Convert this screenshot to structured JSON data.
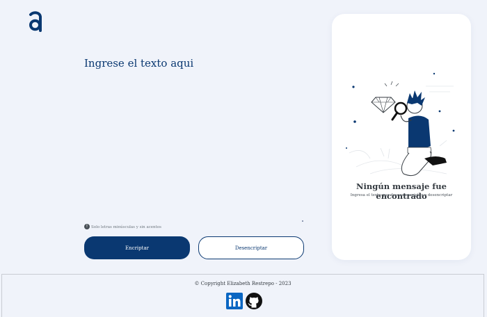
{
  "logo": {
    "letter": "a",
    "color": "#0a3871"
  },
  "input": {
    "placeholder": "Ingrese el texto aqui",
    "value": ""
  },
  "hint": {
    "icon": "!",
    "text": "Solo letras minúsculas y sin acentos"
  },
  "buttons": {
    "encrypt_label": "Encriptar",
    "decrypt_label": "Desencriptar"
  },
  "output": {
    "illustration": "boy-magnifying-glass-diamond",
    "title": "Ningún mensaje fue encontrado",
    "subtitle": "Ingresa el texto que deseas encriptar o desencriptar"
  },
  "footer": {
    "copyright": "© Copyright Elizabeth Restrepo - 2023",
    "links": [
      {
        "name": "linkedin-icon",
        "color": "#0a66c2"
      },
      {
        "name": "github-icon",
        "color": "#111111"
      }
    ]
  },
  "colors": {
    "primary": "#0a3871",
    "background": "#f0f3fa",
    "card": "#ffffff"
  }
}
